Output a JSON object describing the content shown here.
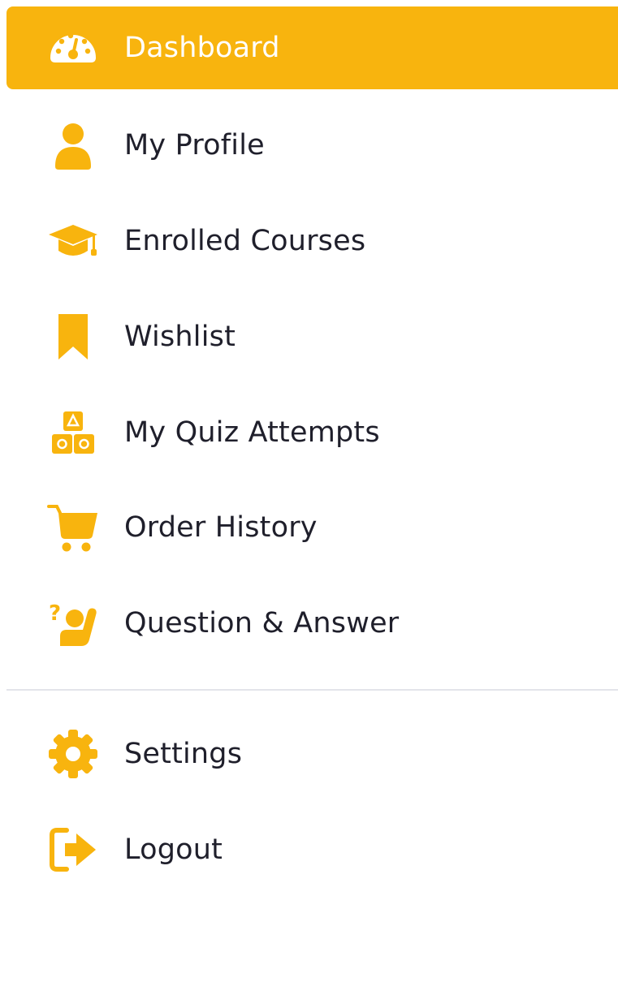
{
  "theme": {
    "accent": "#F8B40E",
    "text": "#1f1f2b",
    "active_text": "#ffffff",
    "divider": "#e3e4ea"
  },
  "menu": {
    "items": [
      {
        "label": "Dashboard",
        "icon": "dashboard-gauge-icon",
        "active": true
      },
      {
        "label": "My Profile",
        "icon": "user-icon"
      },
      {
        "label": "Enrolled Courses",
        "icon": "graduation-cap-icon"
      },
      {
        "label": "Wishlist",
        "icon": "bookmark-icon"
      },
      {
        "label": "My Quiz Attempts",
        "icon": "blocks-icon"
      },
      {
        "label": "Order History",
        "icon": "cart-icon"
      },
      {
        "label": "Question & Answer",
        "icon": "question-answer-icon"
      }
    ],
    "bottom_items": [
      {
        "label": "Settings",
        "icon": "gear-icon"
      },
      {
        "label": "Logout",
        "icon": "logout-icon"
      }
    ]
  }
}
